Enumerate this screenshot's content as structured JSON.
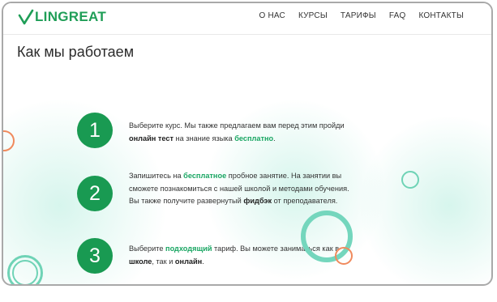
{
  "header": {
    "logo_text": "LINGREAT",
    "nav": [
      "О НАС",
      "КУРСЫ",
      "ТАРИФЫ",
      "FAQ",
      "КОНТАКТЫ"
    ]
  },
  "main": {
    "title": "Как мы работаем",
    "steps": [
      {
        "number": "1",
        "t1": "Выберите курс. Мы также предлагаем вам перед этим пройди ",
        "b1": "онлайн тест",
        "t2": " на знание языка ",
        "h1": "бесплатно",
        "t3": "."
      },
      {
        "number": "2",
        "t1": "Запишитесь на ",
        "h1": "бесплатное",
        "t2": " пробное занятие. На занятии вы сможете познакомиться с нашей школой и методами обучения. Вы также получите развернутый ",
        "b1": "фидбэк",
        "t3": " от преподавателя."
      },
      {
        "number": "3",
        "t1": "Выберите ",
        "h1": "подходящий",
        "t2": " тариф. Вы можете заниматься как в ",
        "b1": "школе",
        "t3": ", так и ",
        "b2": "онлайн",
        "t4": "."
      }
    ]
  },
  "colors": {
    "brand_green": "#199a52",
    "highlight_green": "#1aa663",
    "ring_teal": "#6fd3b6",
    "ring_orange": "#f08a5d"
  },
  "icons": [
    "checkmark-logo-icon"
  ]
}
